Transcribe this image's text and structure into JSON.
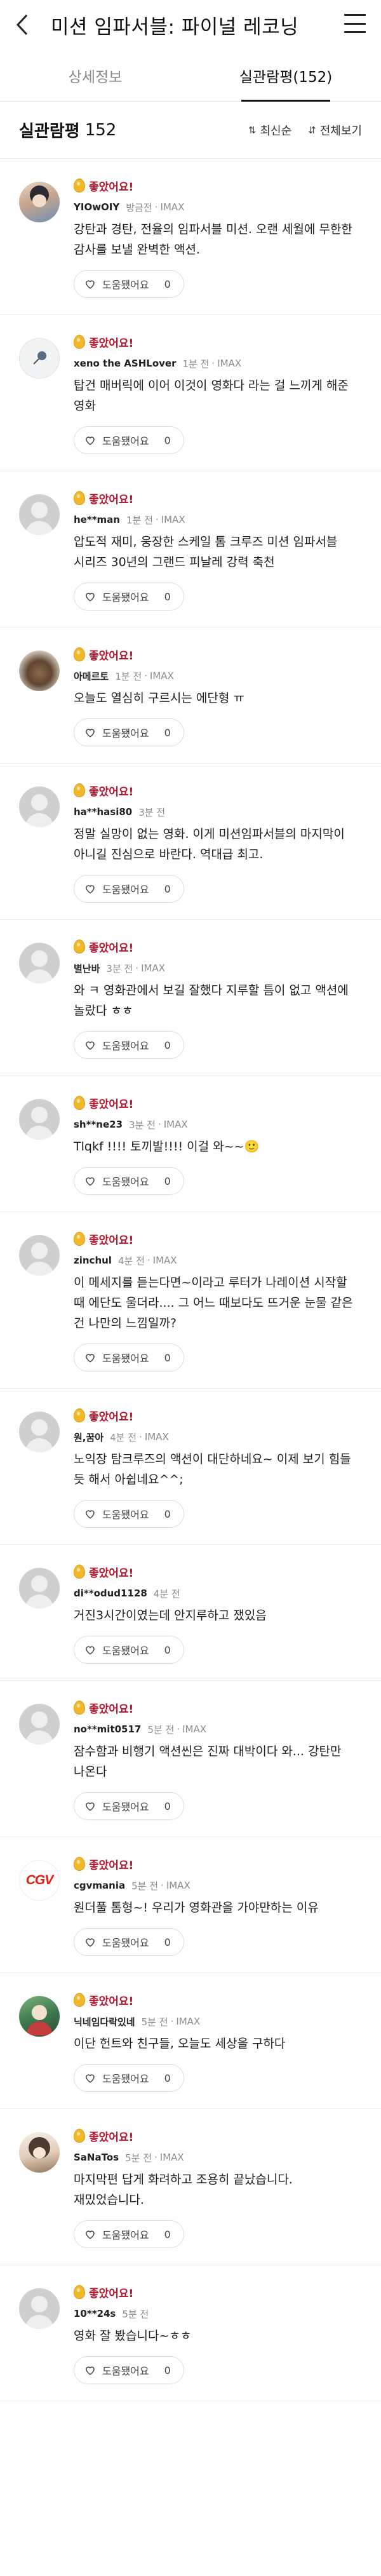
{
  "header": {
    "title": "미션 임파서블: 파이널 레코닝",
    "back_icon": "chevron-left-icon",
    "menu_icon": "hamburger-menu-icon"
  },
  "tabs": [
    {
      "label": "상세정보",
      "active": false
    },
    {
      "label": "실관람평(152)",
      "active": true
    }
  ],
  "section": {
    "title": "실관람평",
    "count": "152",
    "sort_latest": "최신순",
    "sort_all": "전체보기"
  },
  "colors": {
    "badge": "#b5142a",
    "egg": "#f1b82c",
    "cgv_red": "#e71a0f"
  },
  "helpful_label": "도움됐어요",
  "reviews": [
    {
      "badge": "좋았어요!",
      "nickname": "YIOwOIY",
      "time": "방금전",
      "format": "IMAX",
      "text": "강탄과 경탄, 전율의 임파서블 미션. 오랜 세월에 무한한 감사를 보낼 완벽한 액션.",
      "helpful_count": "0",
      "avatar": "anime"
    },
    {
      "badge": "좋았어요!",
      "nickname": "xeno the ASHLover",
      "time": "1분 전",
      "format": "IMAX",
      "text": "탑건 매버릭에 이어 이것이 영화다 라는 걸 느끼게 해준 영화",
      "helpful_count": "0",
      "avatar": "pin"
    },
    {
      "badge": "좋았어요!",
      "nickname": "he**man",
      "time": "1분 전",
      "format": "IMAX",
      "text": "압도적 재미, 웅장한 스케일 톰 크루즈 미션 임파서블 시리즈 30년의 그랜드 피날레 강력 축천",
      "helpful_count": "0",
      "avatar": "default"
    },
    {
      "badge": "좋았어요!",
      "nickname": "아메르토",
      "time": "1분 전",
      "format": "IMAX",
      "text": "오늘도 열심히 구르시는 에단형 ㅠ",
      "helpful_count": "0",
      "avatar": "cat"
    },
    {
      "badge": "좋았어요!",
      "nickname": "ha**hasi80",
      "time": "3분 전",
      "format": "",
      "text": "정말 실망이 없는 영화. 이게 미션임파서블의 마지막이 아니길 진심으로 바란다. 역대급 최고.",
      "helpful_count": "0",
      "avatar": "default"
    },
    {
      "badge": "좋았어요!",
      "nickname": "별난바",
      "time": "3분 전",
      "format": "IMAX",
      "text": "와 ㅋ 영화관에서 보길 잘했다 지루할 틈이 없고 액션에 놀랐다 ㅎㅎ",
      "helpful_count": "0",
      "avatar": "default"
    },
    {
      "badge": "좋았어요!",
      "nickname": "sh**ne23",
      "time": "3분 전",
      "format": "IMAX",
      "text": "Tlqkf !!!! 토끼발!!!! 이걸 와~~🙂",
      "helpful_count": "0",
      "avatar": "default"
    },
    {
      "badge": "좋았어요!",
      "nickname": "zinchul",
      "time": "4분 전",
      "format": "IMAX",
      "text": "이 메세지를 듣는다면~이라고 루터가 나레이션 시작할 때 에단도 울더라.... 그 어느 때보다도 뜨거운 눈물 같은 건 나만의 느낌일까?",
      "helpful_count": "0",
      "avatar": "default"
    },
    {
      "badge": "좋았어요!",
      "nickname": "원,꿈아",
      "time": "4분 전",
      "format": "IMAX",
      "text": "노익장 탐크루즈의 액션이 대단하네요~ 이제 보기 힘들 듯 해서 아쉽네요^^;",
      "helpful_count": "0",
      "avatar": "default"
    },
    {
      "badge": "좋았어요!",
      "nickname": "di**odud1128",
      "time": "4분 전",
      "format": "",
      "text": "거진3시간이였는데 안지루하고 쟀있음",
      "helpful_count": "0",
      "avatar": "default"
    },
    {
      "badge": "좋았어요!",
      "nickname": "no**mit0517",
      "time": "5분 전",
      "format": "IMAX",
      "text": "잠수함과 비행기 액션씬은 진짜 대박이다 와... 강탄만 나온다",
      "helpful_count": "0",
      "avatar": "default"
    },
    {
      "badge": "좋았어요!",
      "nickname": "cgvmania",
      "time": "5분 전",
      "format": "IMAX",
      "text": "원더풀 톰형~! 우리가 영화관을 가야만하는 이유",
      "helpful_count": "0",
      "avatar": "cgv",
      "avatar_text": "CGV"
    },
    {
      "badge": "좋았어요!",
      "nickname": "닉네임다락있네",
      "time": "5분 전",
      "format": "IMAX",
      "text": "이단 헌트와 친구들, 오늘도 세상을 구하다",
      "helpful_count": "0",
      "avatar": "game"
    },
    {
      "badge": "좋았어요!",
      "nickname": "SaNaTos",
      "time": "5분 전",
      "format": "IMAX",
      "text": "마지막편 답게 화려하고 조용히 끝났습니다. 재밌었습니다.",
      "helpful_count": "0",
      "avatar": "anime2"
    },
    {
      "badge": "좋았어요!",
      "nickname": "10**24s",
      "time": "5분 전",
      "format": "",
      "text": "영화 잘 봤습니다~ㅎㅎ",
      "helpful_count": "0",
      "avatar": "default"
    }
  ]
}
